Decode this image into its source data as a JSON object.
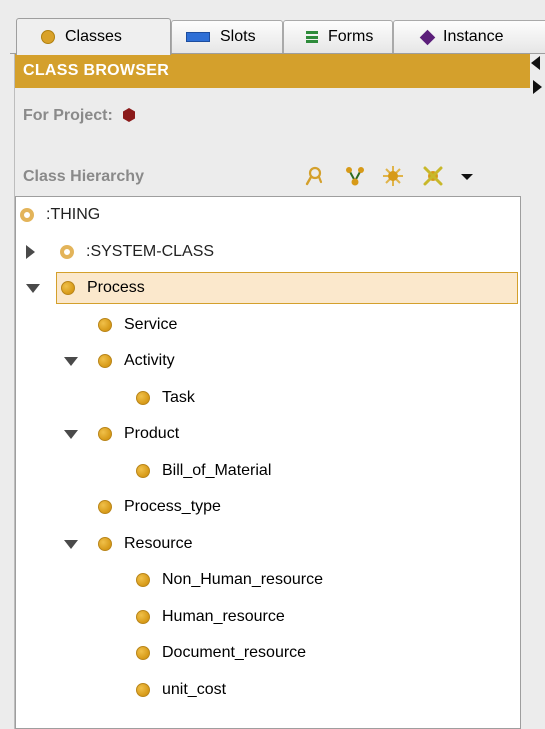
{
  "tabs": [
    {
      "label": "Classes",
      "icon": "class-circle-icon",
      "active": true
    },
    {
      "label": "Slots",
      "icon": "slot-rect-icon",
      "active": false
    },
    {
      "label": "Forms",
      "icon": "form-icon",
      "active": false
    },
    {
      "label": "Instance",
      "icon": "instance-diamond-icon",
      "active": false
    }
  ],
  "header": {
    "title": "CLASS BROWSER"
  },
  "project": {
    "label": "For Project:",
    "icon": "project-hexagon-icon"
  },
  "hierarchy": {
    "label": "Class Hierarchy",
    "tools": [
      "find-class-icon",
      "create-subclass-icon",
      "create-class-icon",
      "delete-class-icon",
      "menu-dropdown-icon"
    ]
  },
  "tree": {
    "nodes": [
      {
        "label": ":THING",
        "depth": 0,
        "toggle": "none",
        "system": true
      },
      {
        "label": ":SYSTEM-CLASS",
        "depth": 1,
        "toggle": "collapsed",
        "system": true
      },
      {
        "label": "Process",
        "depth": 1,
        "toggle": "expanded",
        "selected": true
      },
      {
        "label": "Service",
        "depth": 2,
        "toggle": "none"
      },
      {
        "label": "Activity",
        "depth": 2,
        "toggle": "expanded"
      },
      {
        "label": "Task",
        "depth": 3,
        "toggle": "none"
      },
      {
        "label": "Product",
        "depth": 2,
        "toggle": "expanded"
      },
      {
        "label": "Bill_of_Material",
        "depth": 3,
        "toggle": "none"
      },
      {
        "label": "Process_type",
        "depth": 2,
        "toggle": "none"
      },
      {
        "label": "Resource",
        "depth": 2,
        "toggle": "expanded"
      },
      {
        "label": "Non_Human_resource",
        "depth": 3,
        "toggle": "none"
      },
      {
        "label": "Human_resource",
        "depth": 3,
        "toggle": "none"
      },
      {
        "label": "Document_resource",
        "depth": 3,
        "toggle": "none"
      },
      {
        "label": "unit_cost",
        "depth": 3,
        "toggle": "none"
      }
    ]
  },
  "colors": {
    "accent": "#d4a02c",
    "selection": "#fbe8cc",
    "class_icon": "#d79a18",
    "project_icon": "#8b1a1a"
  }
}
